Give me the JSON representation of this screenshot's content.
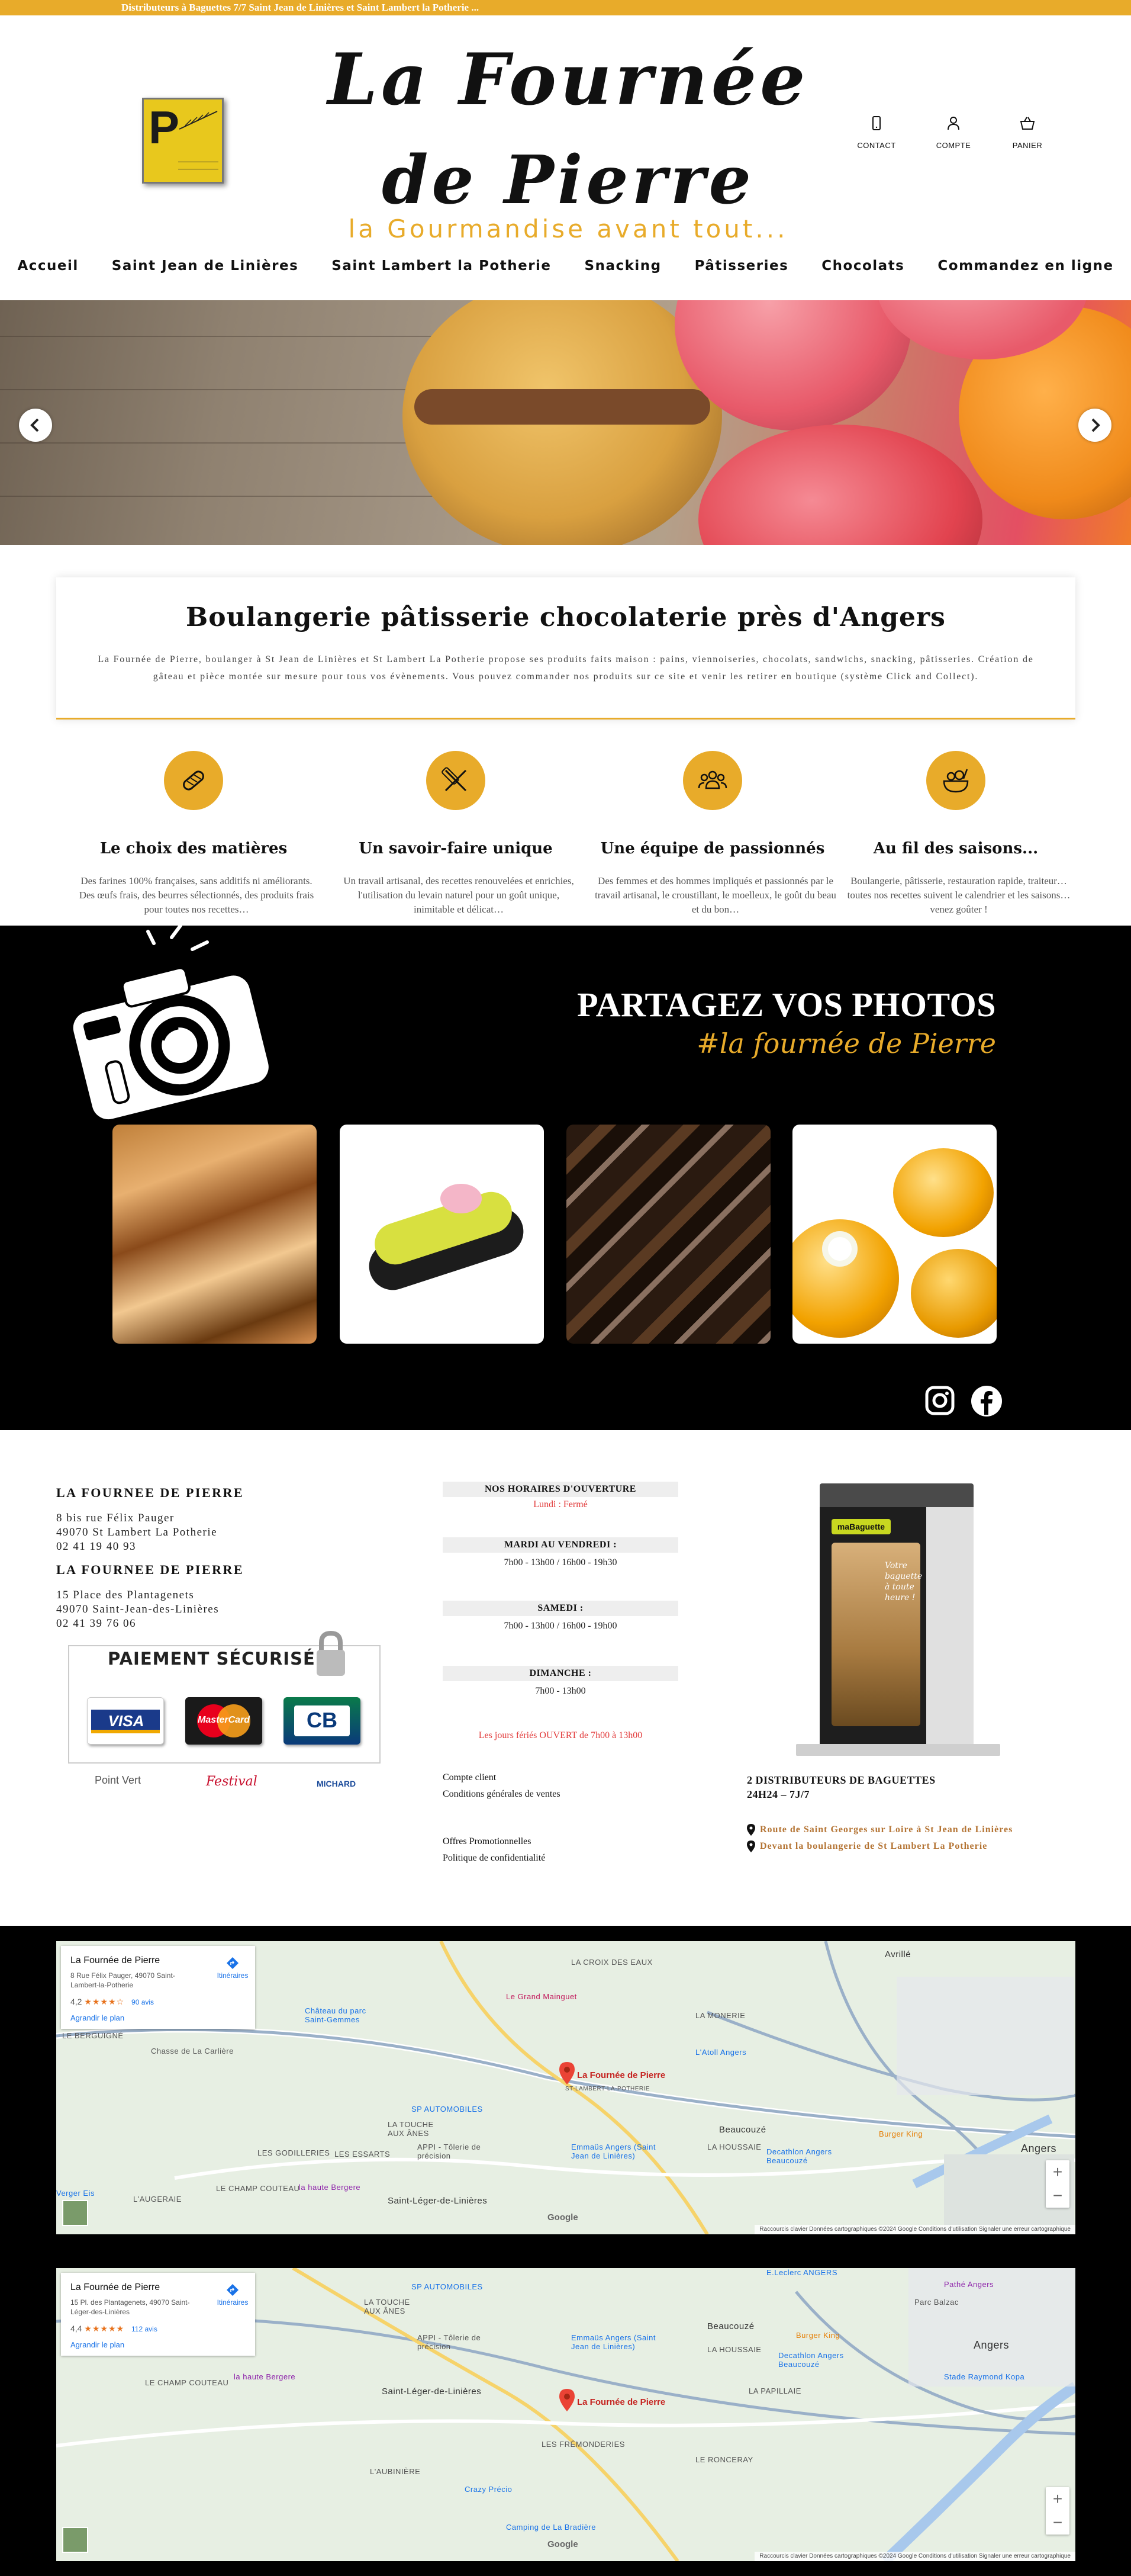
{
  "topbar": {
    "text": "Distributeurs à Baguettes 7/7 Saint Jean de Linières et Saint Lambert la Potherie ..."
  },
  "header": {
    "logo_letter": "P",
    "brand_line1": "La Fournée",
    "brand_line2": "de Pierre",
    "tagline": "la Gourmandise avant tout...",
    "icons": [
      {
        "label": "CONTACT",
        "icon": "phone-icon"
      },
      {
        "label": "COMPTE",
        "icon": "user-icon"
      },
      {
        "label": "PANIER",
        "icon": "basket-icon"
      }
    ]
  },
  "nav": [
    "Accueil",
    "Saint Jean de Linières",
    "Saint Lambert la Potherie",
    "Snacking",
    "Pâtisseries",
    "Chocolats",
    "Commandez en ligne"
  ],
  "intro": {
    "title": "Boulangerie pâtisserie chocolaterie près d'Angers",
    "text": "La Fournée de Pierre, boulanger à St Jean de Linières et St Lambert La Potherie propose ses produits faits maison : pains, viennoiseries, chocolats, sandwichs, snacking, pâtisseries. Création de gâteau et pièce montée sur mesure pour tous vos évènements. Vous pouvez commander nos produits sur ce site et venir les retirer en boutique (système Click and Collect)."
  },
  "features": [
    {
      "icon": "bread-icon",
      "title": "Le choix des matières",
      "text": "Des farines 100% françaises, sans additifs ni améliorants. Des œufs frais, des beurres sélectionnés, des produits frais pour toutes nos recettes…"
    },
    {
      "icon": "rolling-pin-icon",
      "title": "Un savoir-faire unique",
      "text": "Un travail artisanal, des recettes renouvelées et enrichies, l'utilisation du levain naturel pour un goût unique, inimitable et délicat…"
    },
    {
      "icon": "team-icon",
      "title": "Une équipe de passionnés",
      "text": "Des femmes et des hommes impliqués et passionnés par le travail artisanal, le croustillant, le moelleux, le goût du beau et du bon…"
    },
    {
      "icon": "food-bowl-icon",
      "title": "Au fil des saisons...",
      "text": "Boulangerie, pâtisserie, restauration rapide, traiteur… toutes nos recettes suivent le calendrier et les saisons… venez goûter !"
    }
  ],
  "photos": {
    "title": "PARTAGEZ VOS PHOTOS",
    "hashtag": "#la fournée de Pierre",
    "social": [
      "instagram-icon",
      "facebook-icon"
    ]
  },
  "footer": {
    "shops": [
      {
        "name": "LA FOURNEE DE PIERRE",
        "lines": [
          "8 bis rue Félix Pauger",
          "49070 St Lambert La Potherie",
          "02 41 19 40 93"
        ]
      },
      {
        "name": "LA FOURNEE DE PIERRE",
        "lines": [
          "15 Place des Plantagenets",
          "49070 Saint-Jean-des-Linières",
          "02 41 39 76 06"
        ]
      }
    ],
    "payment": {
      "title": "PAIEMENT SÉCURISÉ",
      "cards": [
        "VISA",
        "MasterCard",
        "CB"
      ],
      "partners": [
        "Point Vert",
        "Festival",
        "MICHARD"
      ]
    },
    "hours": {
      "title": "NOS HORAIRES D'OUVERTURE",
      "closed": "Lundi : Fermé",
      "blocks": [
        {
          "day": "MARDI AU VENDREDI :",
          "time": "7h00 - 13h00 / 16h00 - 19h30"
        },
        {
          "day": "SAMEDI :",
          "time": "7h00 - 13h00 / 16h00 - 19h00"
        },
        {
          "day": "DIMANCHE :",
          "time": "7h00 - 13h00"
        }
      ],
      "holiday": "Les jours fériés OUVERT de 7h00 à 13h00"
    },
    "links1": [
      "Compte client",
      "Conditions générales de ventes"
    ],
    "links2": [
      "Offres Promotionnelles",
      "Politique de confidentialité"
    ],
    "distributors": {
      "title": "2 DISTRIBUTEURS DE BAGUETTES",
      "subtitle": "24H24 – 7J/7",
      "machine_brand": "maBaguette",
      "machine_text": "Votre baguette à toute heure !",
      "links": [
        "Route de Saint Georges sur Loire à St Jean de Linières",
        "Devant la boulangerie de St Lambert La Potherie"
      ]
    }
  },
  "maps": [
    {
      "name": "La Fournée de Pierre",
      "address": "8 Rue Félix Pauger, 49070 Saint-Lambert-la-Potherie",
      "rating": "4,2",
      "stars": "★★★★☆",
      "reviews": "90 avis",
      "enlarge": "Agrandir le plan",
      "itinerary": "Itinéraires",
      "pin_label": "La Fournée de Pierre",
      "places": [
        "LA CROIX DES EAUX",
        "Avrillé",
        "Le Grand Mainguet",
        "Château du parc Saint-Gemmes",
        "LA MONERIE",
        "L'Atoll Angers",
        "ST-LAMBERT-LA-POTHERIE",
        "SP AUTOMOBILES",
        "LA TOUCHE AUX ÂNES",
        "LES GODILLERIES",
        "LES ESSARTS",
        "APPI - Tôlerie de précision",
        "Emmaüs Angers (Saint Jean de Linières)",
        "LA HOUSSAIE",
        "Beaucouzé",
        "Decathlon Angers Beaucouzé",
        "Burger King",
        "Angers",
        "LE CHAMP COUTEAU",
        "L'AUGERAIE",
        "la haute Bergere",
        "Saint-Léger-de-Linières",
        "Verger Eis",
        "LE BERGUIGNÉ",
        "Chasse de La Carlière"
      ],
      "google": "Google",
      "attribution": "Raccourcis clavier   Données cartographiques ©2024 Google   Conditions d'utilisation   Signaler une erreur cartographique"
    },
    {
      "name": "La Fournée de Pierre",
      "address": "15 Pl. des Plantagenets, 49070 Saint-Léger-des-Linières",
      "rating": "4,4",
      "stars": "★★★★★",
      "reviews": "112 avis",
      "enlarge": "Agrandir le plan",
      "itinerary": "Itinéraires",
      "pin_label": "La Fournée de Pierre",
      "places": [
        "SP AUTOMOBILES",
        "LA TOUCHE AUX ÂNES",
        "APPI - Tôlerie de précision",
        "Emmaüs Angers (Saint Jean de Linières)",
        "LA HOUSSAIE",
        "Beaucouzé",
        "Decathlon Angers Beaucouzé",
        "Burger King",
        "Angers",
        "la haute Bergere",
        "LE CHAMP COUTEAU",
        "Saint-Léger-de-Linières",
        "LES FRÉMONDERIES",
        "LE RONCERAY",
        "L'AUBINIÈRE",
        "Crazy Précio",
        "Camping de La Bradière",
        "LA PAPILLAIE",
        "Stade Raymond Kopa",
        "Parc Balzac",
        "Pathé Angers",
        "E.Leclerc ANGERS"
      ],
      "google": "Google",
      "attribution": "Raccourcis clavier   Données cartographiques ©2024 Google   Conditions d'utilisation   Signaler une erreur cartographique"
    }
  ],
  "colors": {
    "accent": "#e8ab2a",
    "link": "#b47434",
    "alert": "#e23a3a"
  }
}
